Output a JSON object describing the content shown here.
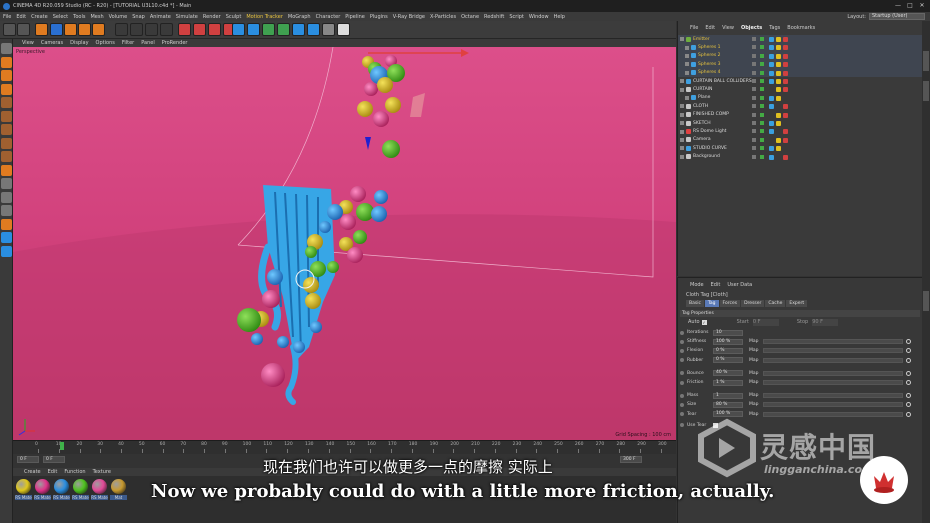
{
  "window": {
    "title": "CINEMA 4D R20.059 Studio (RC - R20) - [TUTORIAL U3L10.c4d *] - Main",
    "controls": [
      "—",
      "□",
      "✕"
    ]
  },
  "menubar": {
    "items": [
      "File",
      "Edit",
      "Create",
      "Select",
      "Tools",
      "Mesh",
      "Volume",
      "Snap",
      "Animate",
      "Simulate",
      "Render",
      "Sculpt",
      "Motion Tracker",
      "MoGraph",
      "Character",
      "Pipeline",
      "Plugins",
      "V-Ray Bridge",
      "X-Particles",
      "Octane",
      "Redshift",
      "Script",
      "Window",
      "Help"
    ],
    "layout_label": "Layout:",
    "layout_value": "Startup (User)"
  },
  "viewport": {
    "menu": [
      "View",
      "Cameras",
      "Display",
      "Options",
      "Filter",
      "Panel",
      "ProRender"
    ],
    "camera_label": "Perspective",
    "grid_spacing": "Grid Spacing : 100 cm",
    "background_color": "#d84b86"
  },
  "timeline": {
    "ticks": [
      "0",
      "10",
      "20",
      "30",
      "40",
      "50",
      "60",
      "70",
      "80",
      "90",
      "100",
      "110",
      "120",
      "130",
      "140",
      "150",
      "160",
      "170",
      "180",
      "190",
      "200",
      "210",
      "220",
      "230",
      "240",
      "250",
      "260",
      "270",
      "280",
      "290",
      "300"
    ],
    "current_frame_fraction": 0.12,
    "start_field": "0 F",
    "current_field": "0 F",
    "end_field": "300 F"
  },
  "materials": {
    "menu": [
      "Create",
      "Edit",
      "Function",
      "Texture"
    ],
    "items": [
      {
        "label": "RS Mate",
        "color": "#e0c81c"
      },
      {
        "label": "RS Mate",
        "color": "#e0338a"
      },
      {
        "label": "RS Mate",
        "color": "#2a8ee0"
      },
      {
        "label": "RS Mate",
        "color": "#4fc21f"
      },
      {
        "label": "RS Mate",
        "color": "#e24a98"
      },
      {
        "label": "Mat",
        "color": "#c89a30"
      }
    ]
  },
  "objects": {
    "tabs": [
      "File",
      "Edit",
      "View",
      "Objects",
      "Tags",
      "Bookmarks"
    ],
    "active_tab": "Objects",
    "rows": [
      {
        "name": "Emitter",
        "indent": 1,
        "selected": true,
        "icon": "#6fae3e"
      },
      {
        "name": "Spheres 1",
        "indent": 2,
        "selected": true,
        "icon": "#3fa0e0"
      },
      {
        "name": "Spheres 2",
        "indent": 2,
        "selected": true,
        "icon": "#3fa0e0"
      },
      {
        "name": "Spheres 3",
        "indent": 2,
        "selected": true,
        "icon": "#3fa0e0"
      },
      {
        "name": "Spheres 4",
        "indent": 2,
        "selected": true,
        "icon": "#3fa0e0"
      },
      {
        "name": "CURTAIN BALL COLLIDERS",
        "indent": 1,
        "selected": false,
        "icon": "#3fa0e0"
      },
      {
        "name": "CURTAIN",
        "indent": 1,
        "selected": false,
        "icon": "#c8c8c8"
      },
      {
        "name": "Plane",
        "indent": 2,
        "selected": false,
        "icon": "#3fa0e0"
      },
      {
        "name": "CLOTH",
        "indent": 1,
        "selected": false,
        "icon": "#c8c8c8"
      },
      {
        "name": "FINISHED COMP",
        "indent": 1,
        "selected": false,
        "icon": "#c8c8c8"
      },
      {
        "name": "SKETCH",
        "indent": 1,
        "selected": false,
        "icon": "#c8c8c8"
      },
      {
        "name": "RS Dome Light",
        "indent": 1,
        "selected": false,
        "icon": "#e04040"
      },
      {
        "name": "Camera",
        "indent": 1,
        "selected": false,
        "icon": "#c8c8c8"
      },
      {
        "name": "STUDIO CURVE",
        "indent": 1,
        "selected": false,
        "icon": "#3fa0e0"
      },
      {
        "name": "Background",
        "indent": 1,
        "selected": false,
        "icon": "#c8c8c8"
      }
    ]
  },
  "attributes": {
    "menu": [
      "Mode",
      "Edit",
      "User Data"
    ],
    "title": "Cloth Tag [Cloth]",
    "tabs": [
      "Basic",
      "Tag",
      "Forces",
      "Dresser",
      "Cache",
      "Expert"
    ],
    "active_tab": "Tag",
    "section": "Tag Properties",
    "auto_label": "Auto",
    "start_label": "Start",
    "start_value": "0 F",
    "stop_label": "Stop",
    "stop_value": "90 F",
    "map_label": "Map",
    "props": [
      {
        "label": "Iterations",
        "value": "10",
        "map": false
      },
      {
        "label": "Stiffness",
        "value": "100 %",
        "map": true
      },
      {
        "label": "Flexion",
        "value": "0 %",
        "map": true
      },
      {
        "label": "Rubber",
        "value": "0 %",
        "map": true
      },
      {
        "label": "Bounce",
        "value": "40 %",
        "map": true
      },
      {
        "label": "Friction",
        "value": "1 %",
        "map": true
      },
      {
        "label": "Mass",
        "value": "1",
        "map": true
      },
      {
        "label": "Size",
        "value": "80 %",
        "map": true
      },
      {
        "label": "Tear",
        "value": "100 %",
        "map": true
      },
      {
        "label": "Use Tear",
        "value": "",
        "map": false
      }
    ]
  },
  "subtitles": {
    "zh": "现在我们也许可以做更多一点的摩擦 实际上",
    "en": "Now we probably could do with a little more friction, actually."
  },
  "watermark": {
    "cn": "灵感中国",
    "en": "lingganchina.com"
  }
}
